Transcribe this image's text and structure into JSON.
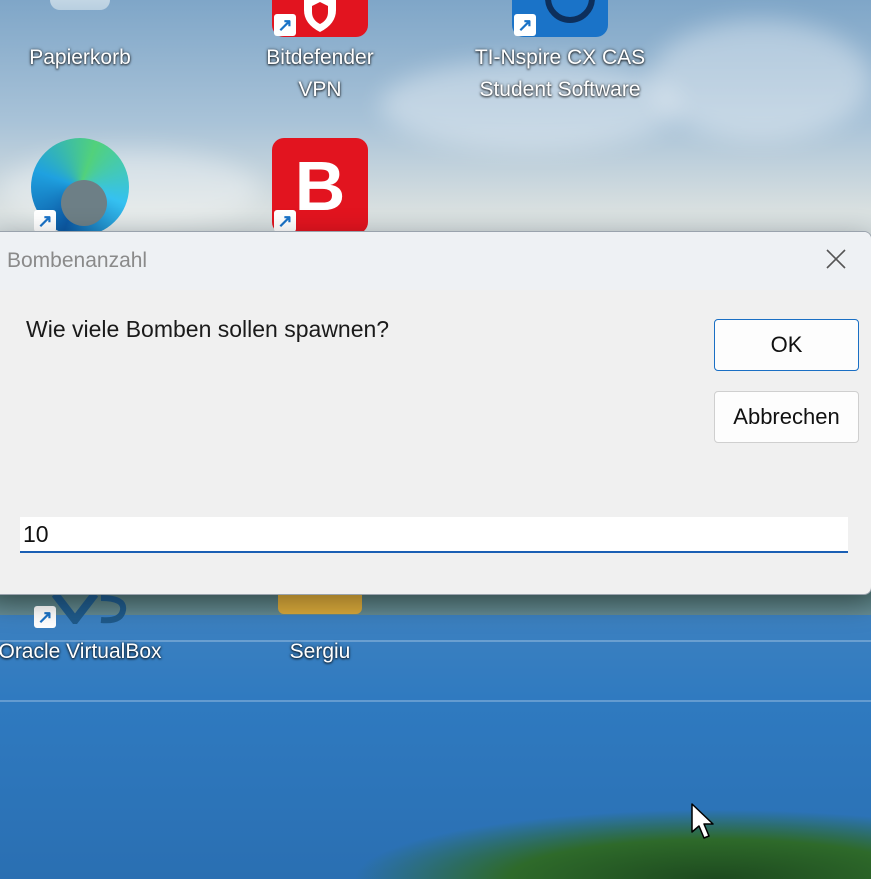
{
  "desktop": {
    "icons": [
      {
        "label": "Papierkorb",
        "icon": "recycle-bin-icon"
      },
      {
        "label": "Bitdefender VPN",
        "icon": "bitdefender-vpn-icon"
      },
      {
        "label": "TI-Nspire CX CAS Student Software",
        "label_line1": "TI-Nspire CX CAS",
        "label_line2": "Student Software",
        "icon": "ti-nspire-icon"
      },
      {
        "label": "",
        "icon": "edge-icon"
      },
      {
        "label": "",
        "icon": "bitdefender-icon",
        "glyph": "B"
      },
      {
        "label": "Oracle VirtualBox",
        "icon": "virtualbox-icon"
      },
      {
        "label": "Sergiu",
        "icon": "folder-icon"
      }
    ],
    "shortcut_glyph": "↗"
  },
  "dialog": {
    "title": "Bombenanzahl",
    "close_glyph": "✕",
    "prompt": "Wie viele Bomben sollen spawnen?",
    "ok_label": "OK",
    "cancel_label": "Abbrechen",
    "input_value": "10"
  },
  "colors": {
    "accent": "#1a6fc4",
    "bitdefender_red": "#e2141f"
  }
}
